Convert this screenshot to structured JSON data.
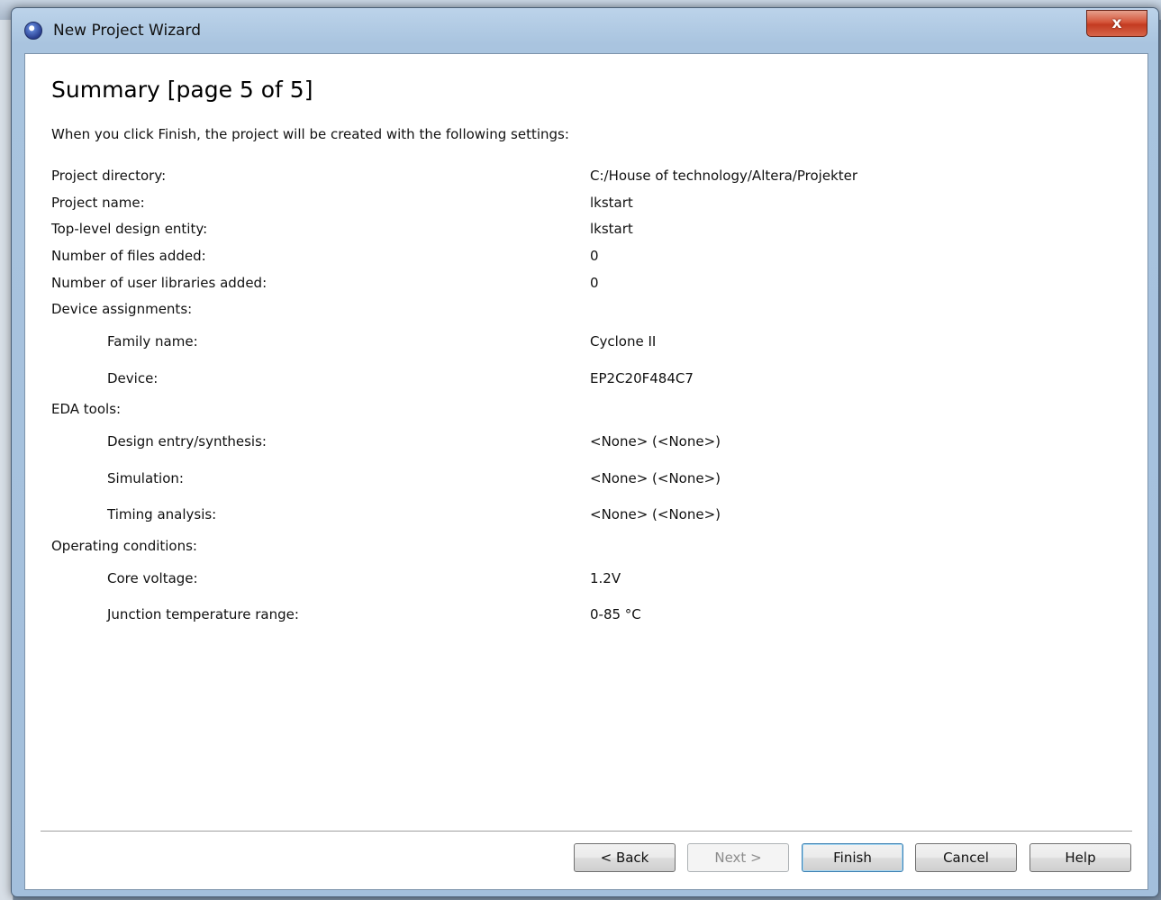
{
  "window": {
    "title": "New Project Wizard",
    "close_label": "x"
  },
  "page": {
    "title": "Summary [page 5 of 5]",
    "intro": "When you click Finish, the project will be created with the following settings:"
  },
  "settings": [
    {
      "label": "Project directory:",
      "value": "C:/House of technology/Altera/Projekter",
      "indent": false
    },
    {
      "label": "Project name:",
      "value": "lkstart",
      "indent": false
    },
    {
      "label": "Top-level design entity:",
      "value": "lkstart",
      "indent": false
    },
    {
      "label": "Number of files added:",
      "value": "0",
      "indent": false
    },
    {
      "label": "Number of user libraries added:",
      "value": "0",
      "indent": false
    },
    {
      "label": "Device assignments:",
      "value": "",
      "indent": false
    },
    {
      "label": "Family name:",
      "value": "Cyclone II",
      "indent": true
    },
    {
      "label": "Device:",
      "value": "EP2C20F484C7",
      "indent": true
    },
    {
      "label": "EDA tools:",
      "value": "",
      "indent": false
    },
    {
      "label": "Design entry/synthesis:",
      "value": "<None> (<None>)",
      "indent": true
    },
    {
      "label": "Simulation:",
      "value": "<None> (<None>)",
      "indent": true
    },
    {
      "label": "Timing analysis:",
      "value": "<None> (<None>)",
      "indent": true
    },
    {
      "label": "Operating conditions:",
      "value": "",
      "indent": false
    },
    {
      "label": "Core voltage:",
      "value": "1.2V",
      "indent": true
    },
    {
      "label": "Junction temperature range:",
      "value": "0-85 °C",
      "indent": true
    }
  ],
  "buttons": {
    "back": "< Back",
    "next": "Next >",
    "finish": "Finish",
    "cancel": "Cancel",
    "help": "Help"
  }
}
